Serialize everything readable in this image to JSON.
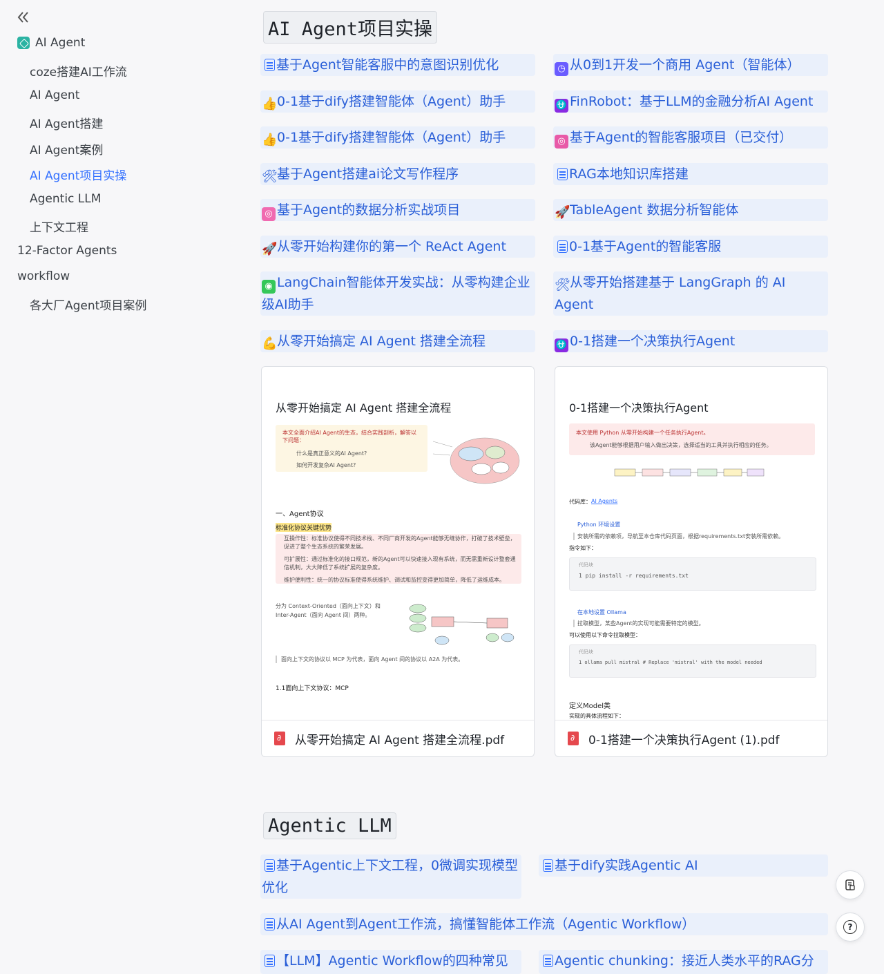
{
  "sidebar": {
    "root_label": "AI Agent",
    "items": [
      {
        "label": "coze搭建AI工作流"
      },
      {
        "label": "AI Agent"
      },
      {
        "label": "AI Agent搭建"
      },
      {
        "label": "AI Agent案例"
      },
      {
        "label": "AI Agent项目实操"
      },
      {
        "label": "Agentic LLM"
      },
      {
        "label": "上下文工程"
      },
      {
        "label": "12-Factor Agents"
      },
      {
        "label": "workflow"
      },
      {
        "label": "各大厂Agent项目案例"
      }
    ]
  },
  "section1": {
    "title": "AI Agent项目实操",
    "links": [
      {
        "icon": "doc-icon",
        "text": "基于Agent智能客服中的意图识别优化"
      },
      {
        "icon": "clock-icon",
        "text": "从0到1开发一个商用 Agent（智能体）"
      },
      {
        "icon": "thumbs-up-icon",
        "glyph": "👍",
        "text": "0-1基于dify搭建智能体（Agent）助手"
      },
      {
        "icon": "purple-emoji-icon",
        "glyph": "⛎",
        "text": "FinRobot：基于LLM的金融分析AI Agent"
      },
      {
        "icon": "thumbs-up-icon",
        "glyph": "👍",
        "text": "0-1基于dify搭建智能体（Agent）助手"
      },
      {
        "icon": "game-icon",
        "glyph": "◎",
        "text": "基于Agent的智能客服项目（已交付）"
      },
      {
        "icon": "tools-icon",
        "glyph": "🛠",
        "text": "基于Agent搭建ai论文写作程序"
      },
      {
        "icon": "doc-icon",
        "text": "RAG本地知识库搭建"
      },
      {
        "icon": "target-icon",
        "glyph": "◎",
        "text": "基于Agent的数据分析实战项目"
      },
      {
        "icon": "rocket-icon",
        "glyph": "🚀",
        "text": "TableAgent 数据分析智能体"
      },
      {
        "icon": "rocket-icon",
        "glyph": "🚀",
        "text": "从零开始构建你的第一个 ReAct Agent"
      },
      {
        "icon": "doc-icon",
        "text": "0-1基于Agent的智能客服"
      },
      {
        "icon": "chat-icon",
        "glyph": "◉",
        "text": "LangChain智能体开发实战：从零构建企业级AI助手"
      },
      {
        "icon": "tools-icon",
        "glyph": "🛠",
        "text": "从零开始搭建基于 LangGraph 的 AI Agent"
      },
      {
        "icon": "muscle-icon",
        "glyph": "💪",
        "text": "从零开始搞定 AI Agent 搭建全流程"
      },
      {
        "icon": "purple-emoji-icon",
        "glyph": "⛎",
        "text": "0-1搭建一个决策执行Agent"
      }
    ],
    "cards": [
      {
        "preview_title": "从零开始搞定 AI Agent 搭建全流程",
        "intro": "本文全面介绍AI Agent的生态，结合实践剖析，解答以下问题：",
        "q1": "什么是真正意义的AI Agent?",
        "q2": "如何开发复杂AI Agent?",
        "section": "一、Agent协议",
        "subsection": "标准化协议关键优势",
        "b1": "互操作性：标准协议使得不同技术栈、不同厂商开发的Agent能够无缝协作，打破了技术壁垒，促进了整个生态系统的繁荣发展。",
        "b2": "可扩展性：通过标准化的接口规范，新的Agent可以快速接入现有系统，而无需重新设计整套通信机制，大大降低了系统扩展的复杂度。",
        "b3": "维护便利性：统一的协议标准使得系统维护、调试和监控变得更加简单，降低了运维成本。",
        "split": "分为 Context-Oriented（面向上下文）和 Inter-Agent（面向 Agent 间）两种。",
        "note": "面向上下文的协议以 MCP 为代表，面向 Agent 间的协议以 A2A 为代表。",
        "sub2": "1.1面向上下文协议：MCP",
        "filename": "从零开始搞定 AI Agent 搭建全流程.pdf"
      },
      {
        "preview_title": "0-1搭建一个决策执行Agent",
        "intro": "本文使用 Python 从零开始构建一个任务执行Agent。",
        "intro2": "该Agent能够根据用户输入做出决策，选择适当的工具并执行相应的任务。",
        "repo_label": "代码库：",
        "repo_link": "AI Agents",
        "env": "Python 环境设置",
        "env_desc": "安装所需的依赖项，导航至本仓库代码页面，根据requirements.txt安装所需依赖。",
        "cmd_label": "指令如下：",
        "code_label": "代码块",
        "code1": "1    pip install -r requirements.txt",
        "local": "在本地设置 Ollama",
        "local_desc": "拉取模型，某些Agent的实现可能需要特定的模型。",
        "cmd_label2": "可以使用以下命令拉取模型：",
        "code2": "1    ollama pull mistral  # Replace 'mistral' with the model needed",
        "def": "定义Model类",
        "def_desc": "实现的具体流程如下：",
        "filename": "0-1搭建一个决策执行Agent (1).pdf"
      }
    ]
  },
  "section2": {
    "title": "Agentic LLM",
    "links": [
      {
        "icon": "doc-icon",
        "text": "基于Agentic上下文工程，0微调实现模型优化"
      },
      {
        "icon": "doc-icon",
        "text": "基于dify实践Agentic AI"
      },
      {
        "icon": "doc-icon",
        "text": "从AI Agent到Agent工作流，搞懂智能体工作流（Agentic Workflow）"
      },
      {
        "icon": "doc-icon",
        "text": "【LLM】Agentic Workflow的四种常见"
      },
      {
        "icon": "doc-icon",
        "text": "Agentic chunking：接近人类水平的RAG分"
      }
    ]
  },
  "fabs": [
    {
      "icon": "copy-doc-icon"
    },
    {
      "icon": "help-icon",
      "glyph": "?"
    }
  ],
  "colors": {
    "link": "#2a5fd8",
    "chip_bg": "#eaf0fb",
    "active": "#3370ff"
  }
}
